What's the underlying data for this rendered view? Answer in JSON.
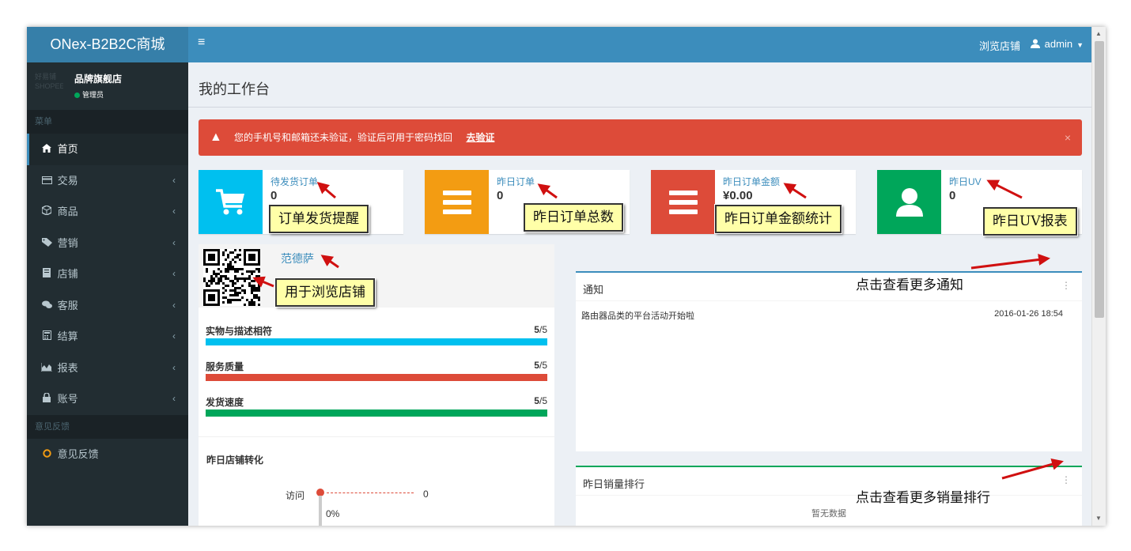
{
  "app": {
    "title": "ONex-B2B2C商城"
  },
  "topbar": {
    "browse_shop": "浏览店铺",
    "user": "admin"
  },
  "user_panel": {
    "avatar_text": "好易铺 SHOPEE",
    "name": "品牌旗舰店",
    "role": "管理员"
  },
  "sidebar": {
    "menu_header": "菜单",
    "items": [
      {
        "label": "首页",
        "icon": "home-icon",
        "active": true
      },
      {
        "label": "交易",
        "icon": "card-icon"
      },
      {
        "label": "商品",
        "icon": "cube-icon"
      },
      {
        "label": "营销",
        "icon": "tag-icon"
      },
      {
        "label": "店铺",
        "icon": "book-icon"
      },
      {
        "label": "客服",
        "icon": "chat-icon"
      },
      {
        "label": "结算",
        "icon": "calculator-icon"
      },
      {
        "label": "报表",
        "icon": "area-chart-icon"
      },
      {
        "label": "账号",
        "icon": "lock-icon"
      }
    ],
    "feedback_header": "意见反馈",
    "feedback_item": "意见反馈"
  },
  "page": {
    "title": "我的工作台"
  },
  "alert": {
    "text": "您的手机号和邮箱还未验证，验证后可用于密码找回",
    "link": "去验证",
    "close": "×"
  },
  "stats": [
    {
      "label": "待发货订单",
      "value": "0",
      "color": "#00c0ef",
      "icon": "cart-icon",
      "callout": "订单发货提醒"
    },
    {
      "label": "昨日订单",
      "value": "0",
      "color": "#f39c12",
      "icon": "list-icon",
      "callout": "昨日订单总数"
    },
    {
      "label": "昨日订单金额",
      "value": "¥0.00",
      "color": "#dd4b39",
      "icon": "list-icon",
      "callout": "昨日订单金额统计"
    },
    {
      "label": "昨日UV",
      "value": "0",
      "color": "#00a65a",
      "icon": "user-icon",
      "callout": "昨日UV报表"
    }
  ],
  "shop": {
    "name": "范德萨",
    "qr_callout": "用于浏览店铺",
    "ratings": [
      {
        "label": "实物与描述相符",
        "score": "5",
        "total": "/5",
        "value": 1.0,
        "color": "#00c0ef"
      },
      {
        "label": "服务质量",
        "score": "5",
        "total": "/5",
        "value": 1.0,
        "color": "#dd4b39"
      },
      {
        "label": "发货速度",
        "score": "5",
        "total": "/5",
        "value": 1.0,
        "color": "#00a65a"
      }
    ],
    "conversion_title": "昨日店铺转化",
    "funnel_label": "访问",
    "funnel_value": "0",
    "funnel_percent": "0%"
  },
  "notice": {
    "title": "通知",
    "more": "⋮",
    "item_text": "路由器品类的平台活动开始啦",
    "item_time": "2016-01-26 18:54",
    "annotation": "点击查看更多通知"
  },
  "sales_rank": {
    "title": "昨日销量排行",
    "more": "⋮",
    "empty": "暂无数据",
    "annotation": "点击查看更多销量排行"
  }
}
